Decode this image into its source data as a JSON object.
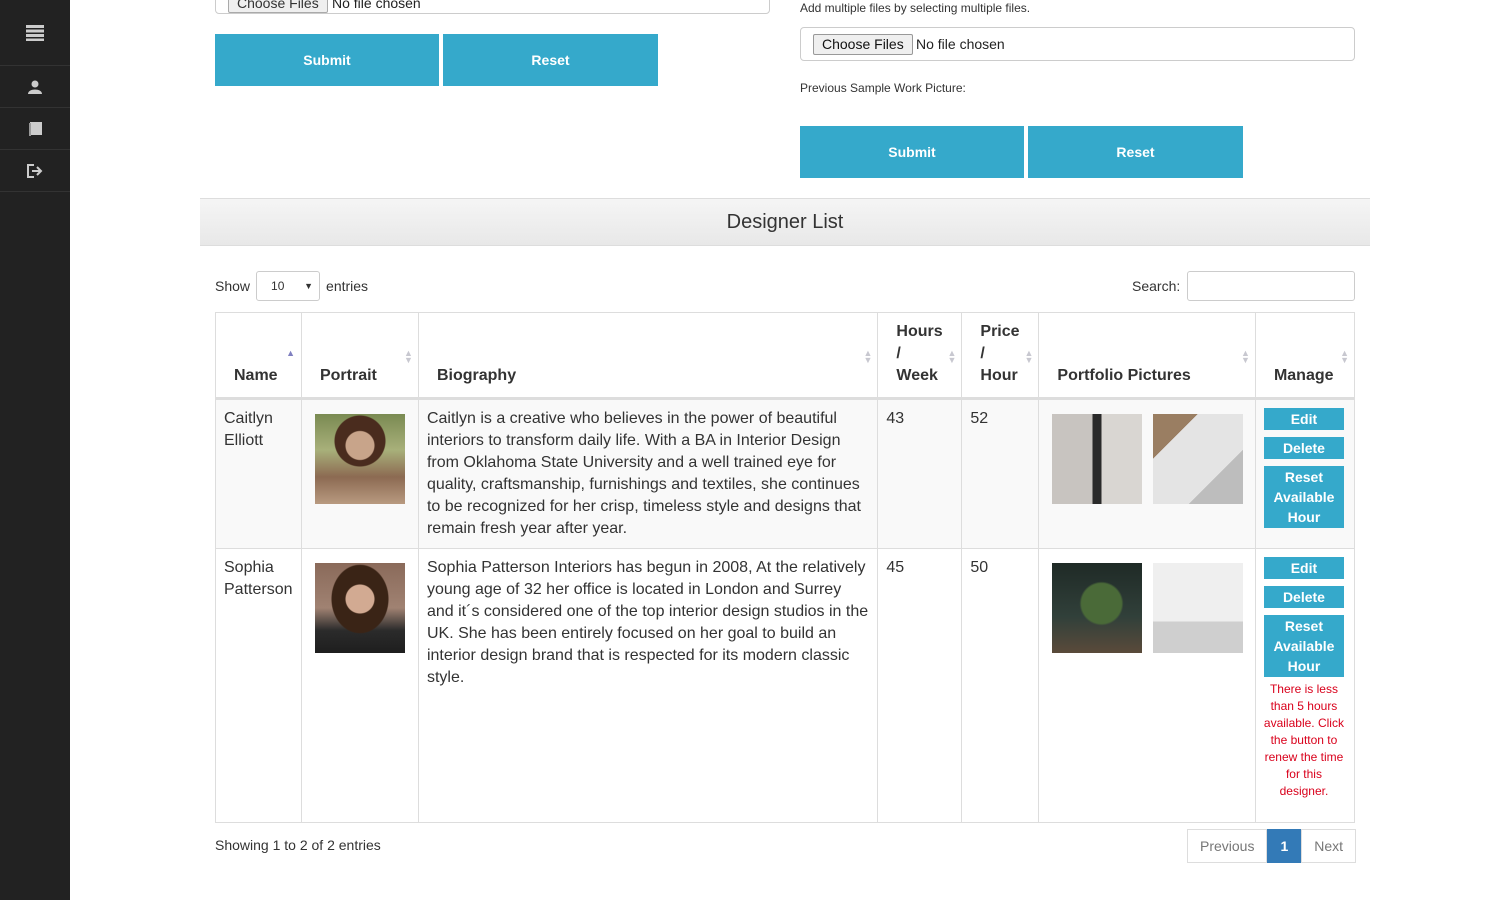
{
  "sidebar": {
    "items": [
      {
        "icon": "menu-icon"
      },
      {
        "icon": "user-icon"
      },
      {
        "icon": "book-icon"
      },
      {
        "icon": "logout-icon"
      }
    ]
  },
  "left_form": {
    "choose_label": "Choose Files",
    "file_status": "No file chosen",
    "submit_label": "Submit",
    "reset_label": "Reset"
  },
  "right_form": {
    "multi_note": "Add multiple files by selecting multiple files.",
    "choose_label": "Choose Files",
    "file_status": "No file chosen",
    "previous_label": "Previous Sample Work Picture:",
    "submit_label": "Submit",
    "reset_label": "Reset"
  },
  "panel": {
    "title": "Designer List"
  },
  "table_controls": {
    "show_label": "Show",
    "length_value": "10",
    "entries_label": "entries",
    "search_label": "Search:"
  },
  "table": {
    "columns": [
      {
        "label": "Name"
      },
      {
        "label": "Portrait"
      },
      {
        "label": "Biography"
      },
      {
        "label": "Hours / Week"
      },
      {
        "label": "Price / Hour"
      },
      {
        "label": "Portfolio Pictures"
      },
      {
        "label": "Manage"
      }
    ],
    "rows": [
      {
        "name": "Caitlyn Elliott",
        "biography": "Caitlyn is a creative who believes in the power of beautiful interiors to transform daily life. With a BA in Interior Design from Oklahoma State University and a well trained eye for quality, craftsmanship, furnishings and textiles, she continues to be recognized for her crisp, timeless style and designs that remain fresh year after year.",
        "hours_week": "43",
        "price_hour": "52",
        "edit": "Edit",
        "delete": "Delete",
        "reset": "Reset Available Hour",
        "warning": ""
      },
      {
        "name": "Sophia Patterson",
        "biography": "Sophia Patterson Interiors has begun in 2008, At the relatively young age of 32 her office is located in London and Surrey and it´s considered one of the top interior design studios in the UK. She has been entirely focused on her goal to build an interior design brand that is respected for its modern classic style.",
        "hours_week": "45",
        "price_hour": "50",
        "edit": "Edit",
        "delete": "Delete",
        "reset": "Reset Available Hour",
        "warning": "There is less than 5 hours available. Click the button to renew the time for this designer."
      }
    ]
  },
  "footer": {
    "info": "Showing 1 to 2 of 2 entries",
    "previous": "Previous",
    "page": "1",
    "next": "Next"
  },
  "colors": {
    "accent": "#35a9cb",
    "sidebar": "#222222",
    "pager_active": "#337ab7",
    "warning": "#d9001b"
  }
}
